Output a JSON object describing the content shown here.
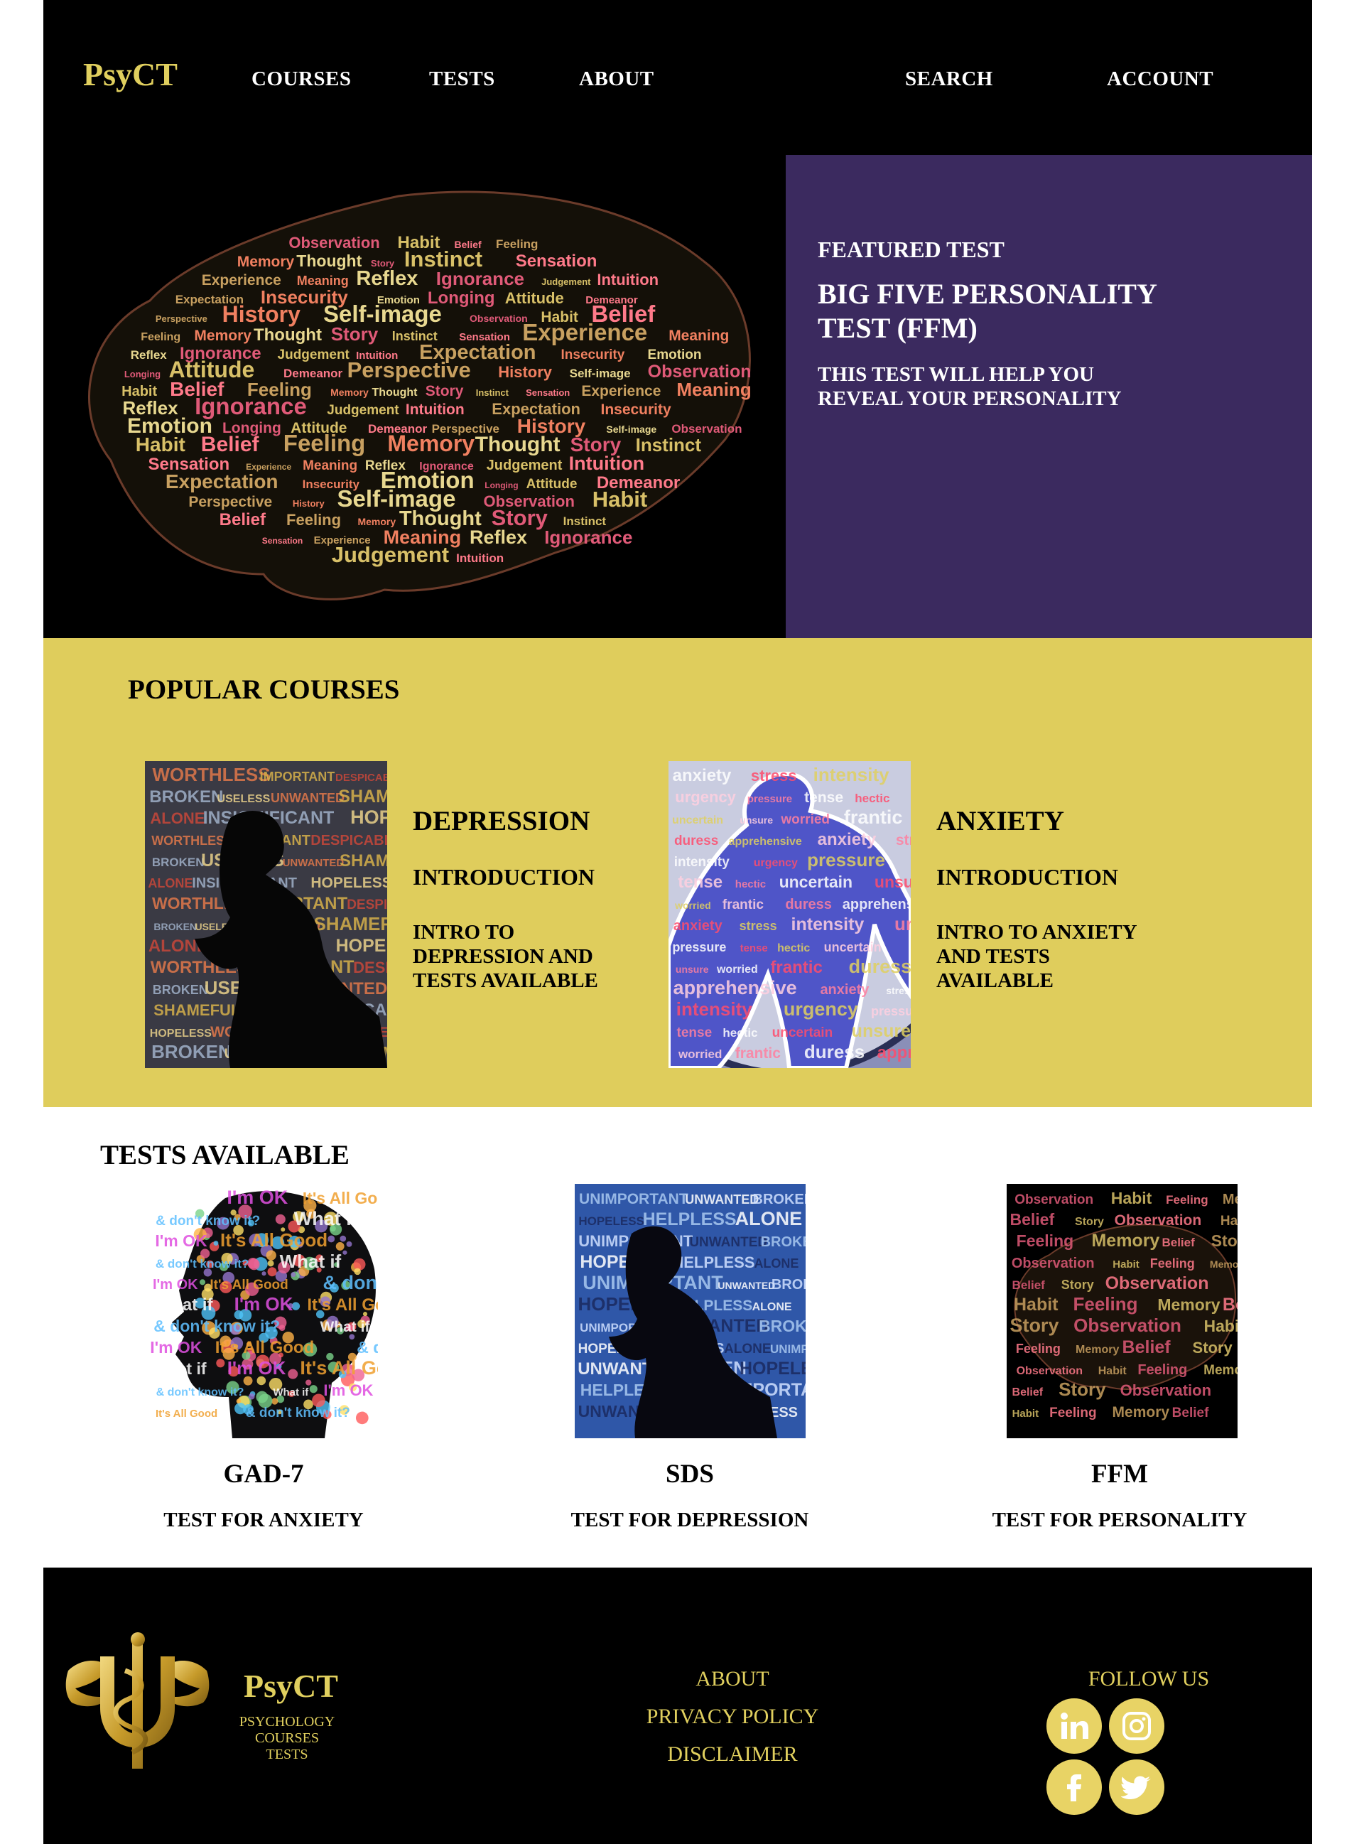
{
  "header": {
    "logo": "PsyCT",
    "nav": [
      "COURSES",
      "TESTS",
      "ABOUT",
      "SEARCH",
      "ACCOUNT"
    ]
  },
  "hero": {
    "featured_label": "FEATURED TEST",
    "featured_title": "BIG FIVE PERSONALITY TEST (FFM)",
    "featured_desc": "THIS TEST WILL HELP  YOU REVEAL  YOUR PERSONALITY",
    "brain_words": [
      "Observation",
      "Habit",
      "Belief",
      "Feeling",
      "Memory",
      "Thought",
      "Story",
      "Instinct",
      "Sensation",
      "Experience",
      "Meaning",
      "Reflex",
      "Ignorance",
      "Judgement",
      "Intuition",
      "Expectation",
      "Insecurity",
      "Emotion",
      "Longing",
      "Attitude",
      "Demeanor",
      "Perspective",
      "History",
      "Self-image"
    ]
  },
  "popular": {
    "heading": "POPULAR COURSES",
    "courses": [
      {
        "title": "DEPRESSION",
        "subtitle": "INTRODUCTION",
        "desc": "INTRO TO DEPRESSION AND TESTS AVAILABLE",
        "words": [
          "WORTHLESS",
          "IMPORTANT",
          "DESPICABLE",
          "BROKEN",
          "USELESS",
          "UNWANTED",
          "SHAMEFUL",
          "ALONE",
          "INSIGNIFICANT",
          "HOPELESS"
        ]
      },
      {
        "title": "ANXIETY",
        "subtitle": "INTRODUCTION",
        "desc": "INTRO TO ANXIETY AND TESTS AVAILABLE",
        "words": [
          "anxiety",
          "stress",
          "intensity",
          "urgency",
          "pressure",
          "tense",
          "hectic",
          "uncertain",
          "unsure",
          "worried",
          "frantic",
          "duress",
          "apprehensive"
        ]
      }
    ]
  },
  "tests": {
    "heading": "TESTS AVAILABLE",
    "items": [
      {
        "name": "GAD-7",
        "desc": "TEST FOR ANXIETY",
        "words": [
          "What if",
          "I'm OK",
          "It's All Good",
          "& don't know it?"
        ]
      },
      {
        "name": "SDS",
        "desc": "TEST FOR DEPRESSION",
        "words": [
          "UNIMPORTANT",
          "UNWANTED",
          "BROKEN",
          "HOPELESS",
          "HELPLESS",
          "ALONE"
        ]
      },
      {
        "name": "FFM",
        "desc": "TEST FOR PERSONALITY",
        "words": [
          "Observation",
          "Habit",
          "Feeling",
          "Memory",
          "Belief",
          "Story"
        ]
      }
    ]
  },
  "footer": {
    "logo": "PsyCT",
    "tagline": [
      "PSYCHOLOGY",
      "COURSES",
      "TESTS"
    ],
    "links": [
      "ABOUT",
      "PRIVACY POLICY",
      "DISCLAIMER"
    ],
    "follow": "FOLLOW US",
    "social_icons": [
      "linkedin-icon",
      "instagram-icon",
      "facebook-icon",
      "twitter-icon"
    ]
  },
  "colors": {
    "accent_gold": "#dfcd5c",
    "featured_purple": "#3b2a5f",
    "logo_gold": "#e0cf5e"
  }
}
